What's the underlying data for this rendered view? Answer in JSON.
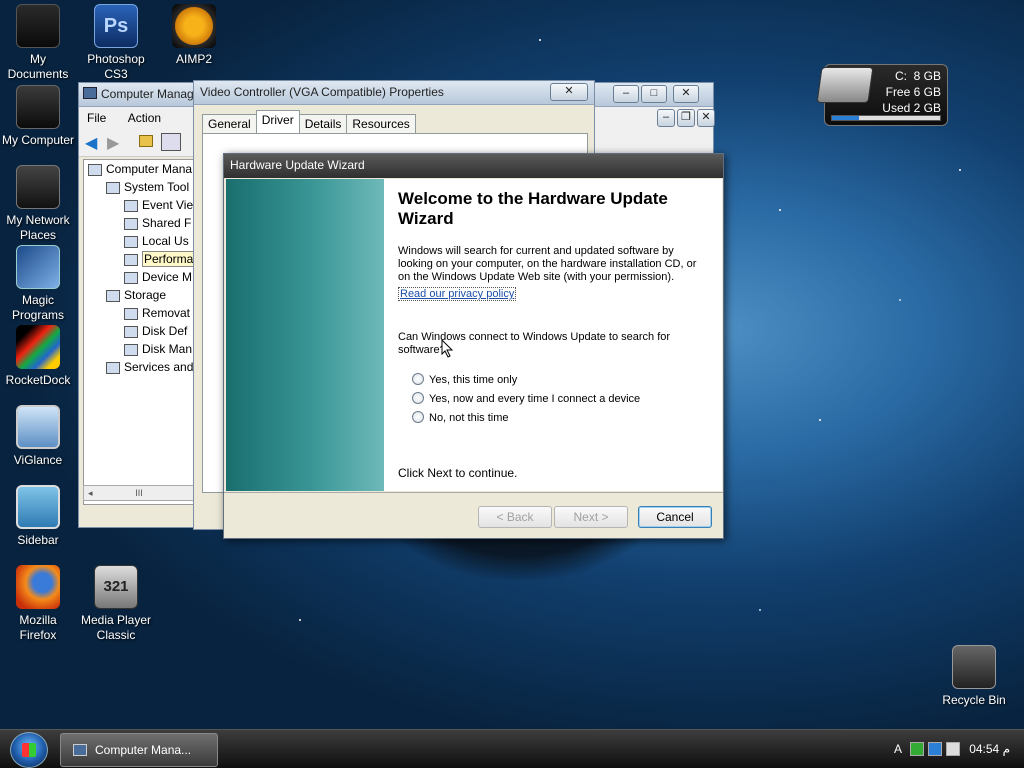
{
  "desktop": {
    "icons": [
      {
        "label": "My\nDocuments",
        "icon": "my-documents-icon"
      },
      {
        "label": "Photoshop\nCS3",
        "icon": "photoshop-icon",
        "glyph": "Ps"
      },
      {
        "label": "AIMP2",
        "icon": "aimp2-icon"
      },
      {
        "label": "My Computer",
        "icon": "my-computer-icon"
      },
      {
        "label": "My Network\nPlaces",
        "icon": "network-places-icon"
      },
      {
        "label": "Magic\nPrograms",
        "icon": "magic-programs-icon"
      },
      {
        "label": "RocketDock",
        "icon": "rocketdock-icon"
      },
      {
        "label": "ViGlance",
        "icon": "viglance-icon"
      },
      {
        "label": "Sidebar",
        "icon": "sidebar-icon"
      },
      {
        "label": "Mozilla\nFirefox",
        "icon": "firefox-icon"
      },
      {
        "label": "Media Player\nClassic",
        "icon": "media-player-classic-icon",
        "glyph": "321"
      },
      {
        "label": "Recycle Bin",
        "icon": "recycle-bin-icon"
      }
    ]
  },
  "drive_gadget": {
    "drive": "C:",
    "total": "8 GB",
    "free_label": "Free",
    "free": "6 GB",
    "used_label": "Used",
    "used": "2 GB",
    "used_fraction": 0.25
  },
  "computer_management": {
    "title": "Computer Manag",
    "menu": [
      "File",
      "Action"
    ],
    "tree": [
      {
        "label": "Computer Mana",
        "level": 0
      },
      {
        "label": "System Tool",
        "level": 1
      },
      {
        "label": "Event Vie",
        "level": 2
      },
      {
        "label": "Shared F",
        "level": 2
      },
      {
        "label": "Local Us",
        "level": 2
      },
      {
        "label": "Performa",
        "level": 2,
        "selected": true
      },
      {
        "label": "Device M",
        "level": 2
      },
      {
        "label": "Storage",
        "level": 1
      },
      {
        "label": "Removat",
        "level": 2
      },
      {
        "label": "Disk Def",
        "level": 2
      },
      {
        "label": "Disk Man",
        "level": 2
      },
      {
        "label": "Services and",
        "level": 1
      }
    ],
    "scroll_grip": "III"
  },
  "properties": {
    "title": "Video Controller (VGA Compatible) Properties",
    "close_glyph": "✕",
    "tabs": [
      "General",
      "Driver",
      "Details",
      "Resources"
    ],
    "active_tab": "Driver"
  },
  "wizard": {
    "title": "Hardware Update Wizard",
    "heading": "Welcome to the Hardware Update Wizard",
    "intro": "Windows will search for current and updated software by looking on your computer, on the hardware installation CD, or on the Windows Update Web site (with your permission).",
    "privacy_link": "Read our privacy policy",
    "question": "Can Windows connect to Windows Update to search for software?",
    "options": [
      "Yes, this time only",
      "Yes, now and every time I connect a device",
      "No, not this time"
    ],
    "footer_text": "Click Next to continue.",
    "back_label": "< Back",
    "next_label": "Next >",
    "cancel_label": "Cancel"
  },
  "taskbar": {
    "task_label": "Computer Mana...",
    "clock": "04:54 م",
    "tray_letter": "A"
  }
}
